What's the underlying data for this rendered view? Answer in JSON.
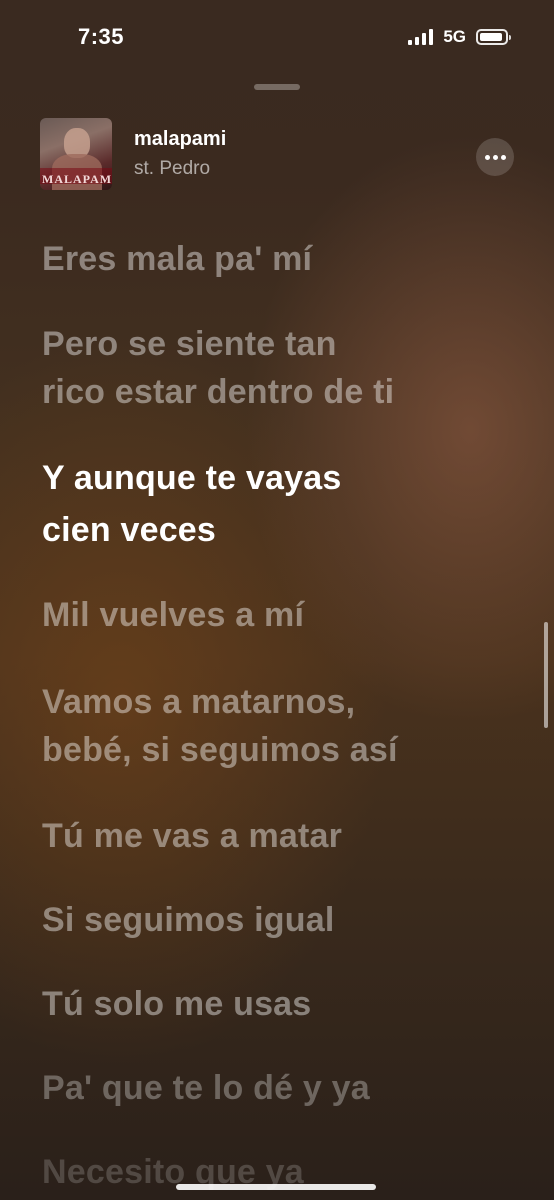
{
  "status": {
    "time": "7:35",
    "network": "5G"
  },
  "now_playing": {
    "artwork_title": "MALAPAMI",
    "title": "malapami",
    "artist": "st. Pedro"
  },
  "lyrics": [
    "Eres mala pa' mí",
    "Pero se siente tan",
    "rico estar dentro de ti",
    "Y aunque te vayas",
    "cien veces",
    "Mil vuelves a mí",
    "Vamos a matarnos,",
    "bebé, si seguimos así",
    "Tú me vas a matar",
    "Si seguimos igual",
    "Tú solo me usas",
    "Pa' que te lo dé y ya",
    "Necesito que ya"
  ]
}
